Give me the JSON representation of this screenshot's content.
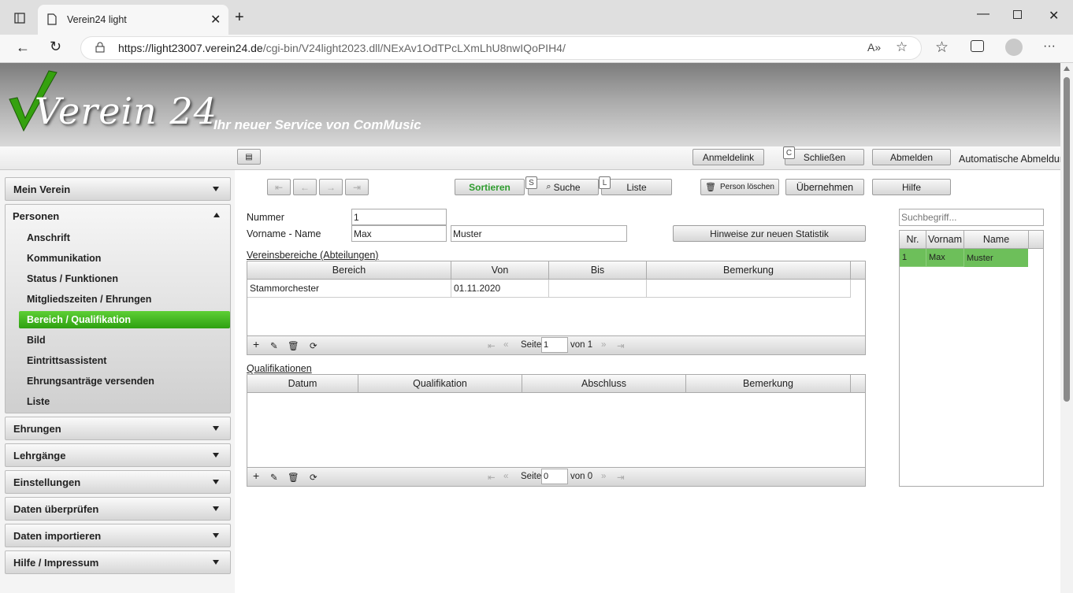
{
  "browser": {
    "tab_title": "Verein24 light",
    "url_host": "https://light23007.verein24.de",
    "url_path": "/cgi-bin/V24light2023.dll/NExAv1OdTPcLXmLhU8nwIQoPIH4/"
  },
  "header": {
    "logo_text": "Verein 24",
    "tagline": "Ihr neuer Service von ComMusic"
  },
  "toolbar": {
    "anmeldelink": "Anmeldelink",
    "schliessen": "Schließen",
    "schliessen_key": "C",
    "abmelden": "Abmelden",
    "auto_logout": "Automatische Abmeldung"
  },
  "sidebar": {
    "mein_verein": "Mein Verein",
    "personen": "Personen",
    "items": [
      "Anschrift",
      "Kommunikation",
      "Status / Funktionen",
      "Mitgliedszeiten / Ehrungen",
      "Bereich / Qualifikation",
      "Bild",
      "Eintrittsassistent",
      "Ehrungsanträge versenden",
      "Liste"
    ],
    "sections": [
      "Ehrungen",
      "Lehrgänge",
      "Einstellungen",
      "Daten überprüfen",
      "Daten importieren",
      "Hilfe / Impressum"
    ]
  },
  "actions": {
    "sortieren": "Sortieren",
    "suche": "Suche",
    "suche_key": "S",
    "liste": "Liste",
    "liste_key": "L",
    "person_loeschen": "Person löschen",
    "uebernehmen": "Übernehmen",
    "hilfe": "Hilfe"
  },
  "form": {
    "nummer_label": "Nummer",
    "nummer": "1",
    "name_label": "Vorname - Name",
    "vorname": "Max",
    "name": "Muster",
    "statistik_button": "Hinweise zur neuen Statistik"
  },
  "vereinsbereiche": {
    "title": "Vereinsbereiche (Abteilungen)",
    "columns": [
      "Bereich",
      "Von",
      "Bis",
      "Bemerkung"
    ],
    "rows": [
      [
        "Stammorchester",
        "01.11.2020",
        "",
        ""
      ]
    ],
    "page_label": "Seite",
    "page": "1",
    "of_label": "von 1"
  },
  "qualifikationen": {
    "title": "Qualifikationen",
    "columns": [
      "Datum",
      "Qualifikation",
      "Abschluss",
      "Bemerkung"
    ],
    "rows": [],
    "page_label": "Seite",
    "page": "0",
    "of_label": "von 0"
  },
  "search": {
    "placeholder": "Suchbegriff...",
    "columns": [
      "Nr.",
      "Vornam",
      "Name"
    ],
    "rows": [
      [
        "1",
        "Max",
        "Muster"
      ]
    ]
  }
}
